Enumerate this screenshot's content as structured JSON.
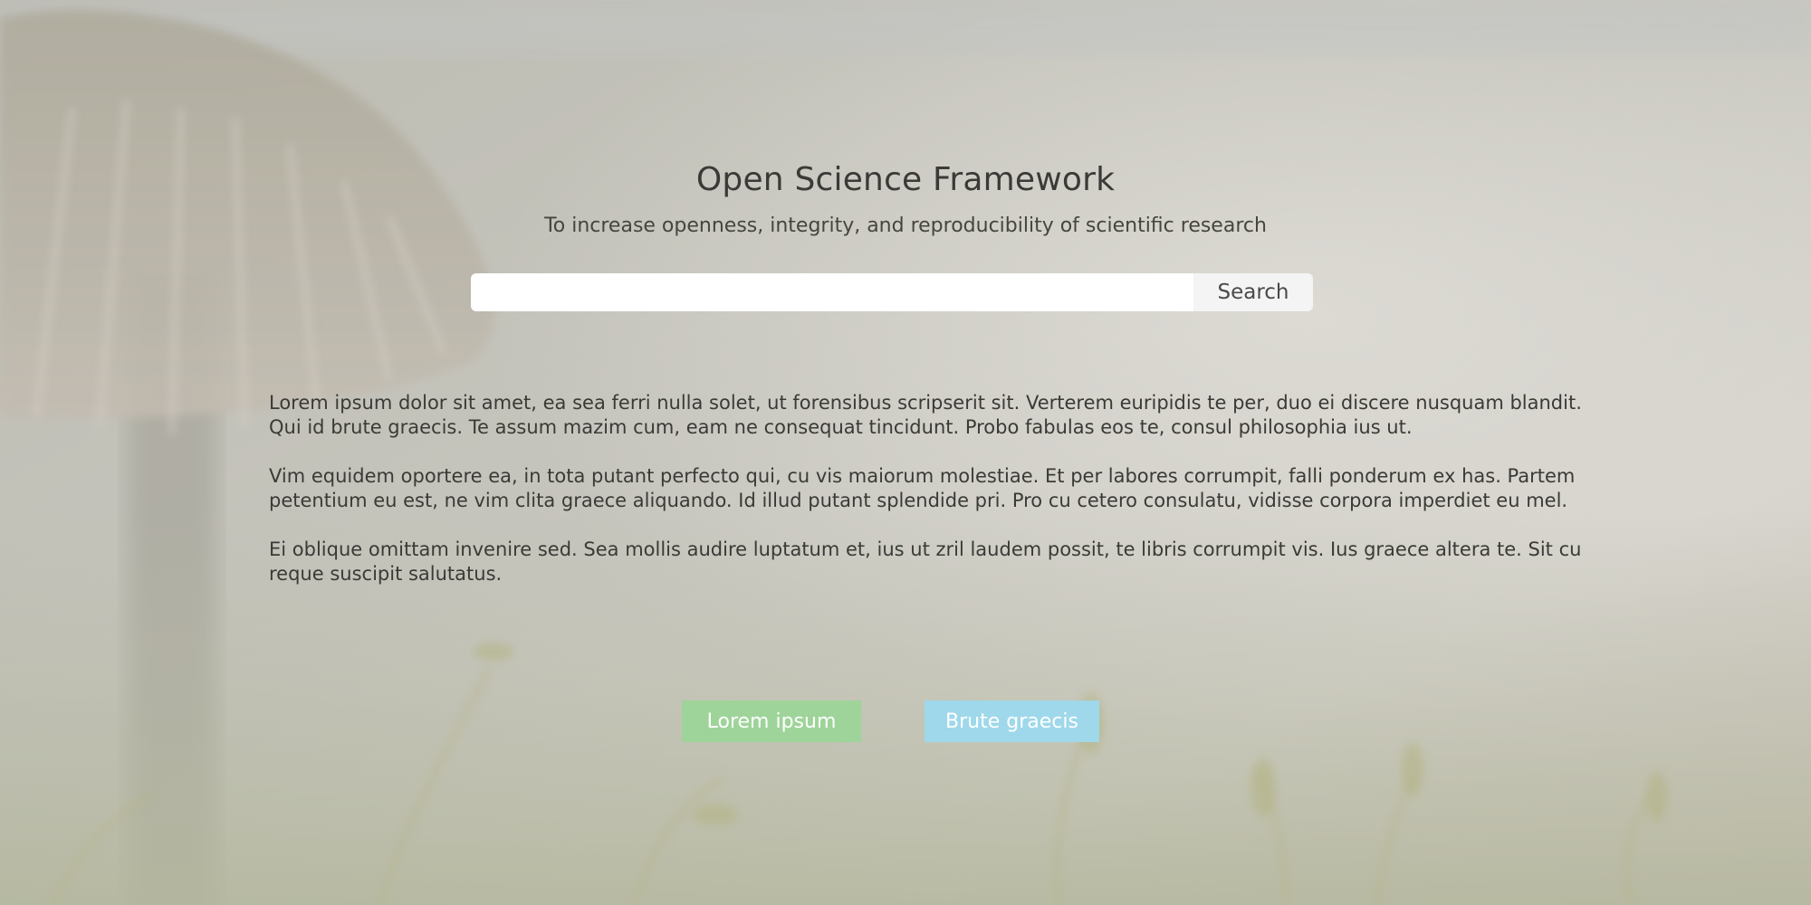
{
  "header": {
    "title": "Open Science Framework",
    "subtitle": "To increase openness, integrity, and reproducibility of scientific research"
  },
  "search": {
    "value": "",
    "placeholder": "",
    "button_label": "Search"
  },
  "body": {
    "paragraphs": [
      "Lorem ipsum dolor sit amet, ea sea ferri nulla solet, ut forensibus scripserit sit. Verterem euripidis te per, duo ei discere nusquam blandit. Qui id brute graecis. Te assum mazim cum, eam ne consequat tincidunt. Probo fabulas eos te, consul philosophia ius ut.",
      "Vim equidem oportere ea, in tota putant perfecto qui, cu vis maiorum molestiae. Et per labores corrumpit, falli ponderum ex has. Partem petentium eu est, ne vim clita graece aliquando. Id illud putant splendide pri. Pro cu cetero consulatu, vidisse corpora imperdiet eu mel.",
      "Ei oblique omittam invenire sed. Sea mollis audire luptatum et, ius ut zril laudem possit, te libris corrumpit vis. Ius graece altera te. Sit cu reque suscipit salutatus."
    ]
  },
  "actions": {
    "primary_label": "Lorem ipsum",
    "secondary_label": "Brute graecis"
  },
  "colors": {
    "primary_button": "#9ed49a",
    "secondary_button": "#9fd8ea",
    "background": "#c4c3bb"
  }
}
